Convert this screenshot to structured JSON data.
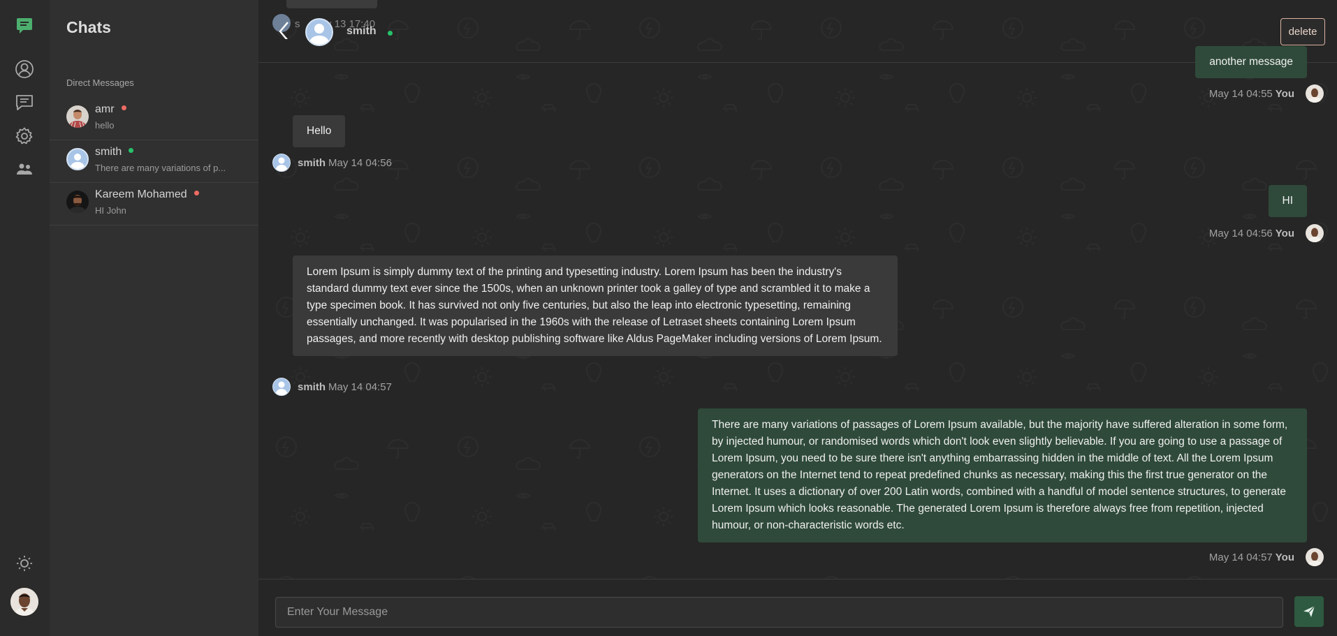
{
  "sidebar": {
    "title": "Chats",
    "section_label": "Direct Messages",
    "items": [
      {
        "name": "amr",
        "preview": "hello",
        "status": "offline",
        "status_color": "#ef6b63"
      },
      {
        "name": "smith",
        "preview": "There are many variations of p...",
        "status": "online",
        "status_color": "#27c26b"
      },
      {
        "name": "Kareem Mohamed",
        "preview": "HI John",
        "status": "offline",
        "status_color": "#ef6b63"
      }
    ]
  },
  "header": {
    "name": "smith",
    "status_color": "#27c26b",
    "ghost_sender_initial": "s",
    "ghost_time": "May 13 17:40",
    "delete_label": "delete"
  },
  "messages": [
    {
      "text": "another message",
      "sender": "You",
      "time": "May 14 04:55"
    },
    {
      "text": "Hello",
      "sender": "smith",
      "time": "May 14 04:56"
    },
    {
      "text": "HI",
      "sender": "You",
      "time": "May 14 04:56"
    },
    {
      "text": "Lorem Ipsum is simply dummy text of the printing and typesetting industry. Lorem Ipsum has been the industry's standard dummy text ever since the 1500s, when an unknown printer took a galley of type and scrambled it to make a type specimen book. It has survived not only five centuries, but also the leap into electronic typesetting, remaining essentially unchanged. It was popularised in the 1960s with the release of Letraset sheets containing Lorem Ipsum passages, and more recently with desktop publishing software like Aldus PageMaker including versions of Lorem Ipsum.",
      "sender": "smith",
      "time": "May 14 04:57"
    },
    {
      "text": "There are many variations of passages of Lorem Ipsum available, but the majority have suffered alteration in some form, by injected humour, or randomised words which don't look even slightly believable. If you are going to use a passage of Lorem Ipsum, you need to be sure there isn't anything embarrassing hidden in the middle of text. All the Lorem Ipsum generators on the Internet tend to repeat predefined chunks as necessary, making this the first true generator on the Internet. It uses a dictionary of over 200 Latin words, combined with a handful of model sentence structures, to generate Lorem Ipsum which looks reasonable. The generated Lorem Ipsum is therefore always free from repetition, injected humour, or non-characteristic words etc.",
      "sender": "You",
      "time": "May 14 04:57"
    }
  ],
  "composer": {
    "placeholder": "Enter Your Message"
  },
  "colors": {
    "brand_accent": "#4caf6e",
    "outgoing_bubble": "#2f4a3a",
    "incoming_bubble": "#3a3a3a",
    "send_button": "#2e5a41"
  },
  "icons": {
    "logo": "chat-logo-icon",
    "profile": "user-circle-icon",
    "chats": "message-square-icon",
    "settings": "gear-icon",
    "contacts": "users-icon",
    "theme": "sun-icon",
    "back": "chevron-left-icon",
    "send": "send-icon"
  }
}
